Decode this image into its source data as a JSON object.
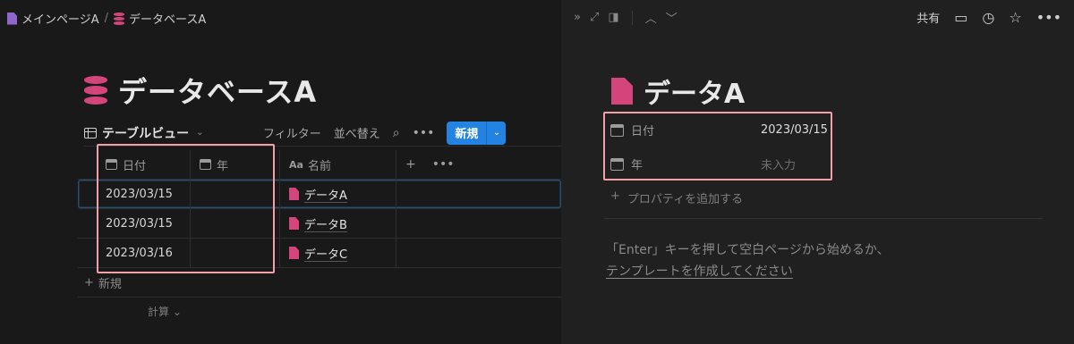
{
  "breadcrumb": {
    "page": "メインページA",
    "separator": "/",
    "database": "データベースA"
  },
  "database": {
    "title": "データベースA",
    "view_name": "テーブルビュー",
    "toolbar": {
      "filter": "フィルター",
      "sort": "並べ替え",
      "new": "新規"
    },
    "columns": [
      "日付",
      "年",
      "名前"
    ],
    "rows": [
      {
        "date": "2023/03/15",
        "year": "",
        "name": "データA"
      },
      {
        "date": "2023/03/15",
        "year": "",
        "name": "データB"
      },
      {
        "date": "2023/03/16",
        "year": "",
        "name": "データC"
      }
    ],
    "add_row": "新規",
    "calc": "計算"
  },
  "topbar": {
    "share": "共有"
  },
  "page": {
    "title": "データA",
    "properties": [
      {
        "name": "日付",
        "value": "2023/03/15"
      },
      {
        "name": "年",
        "value": "未入力"
      }
    ],
    "add_property": "プロパティを追加する",
    "hint_line1": "「Enter」キーを押して空白ページから始めるか、",
    "hint_link": "テンプレートを作成してください"
  },
  "colors": {
    "accent": "#2383e2",
    "icon_pink": "#d4457c",
    "highlight": "#f0a0a6"
  }
}
